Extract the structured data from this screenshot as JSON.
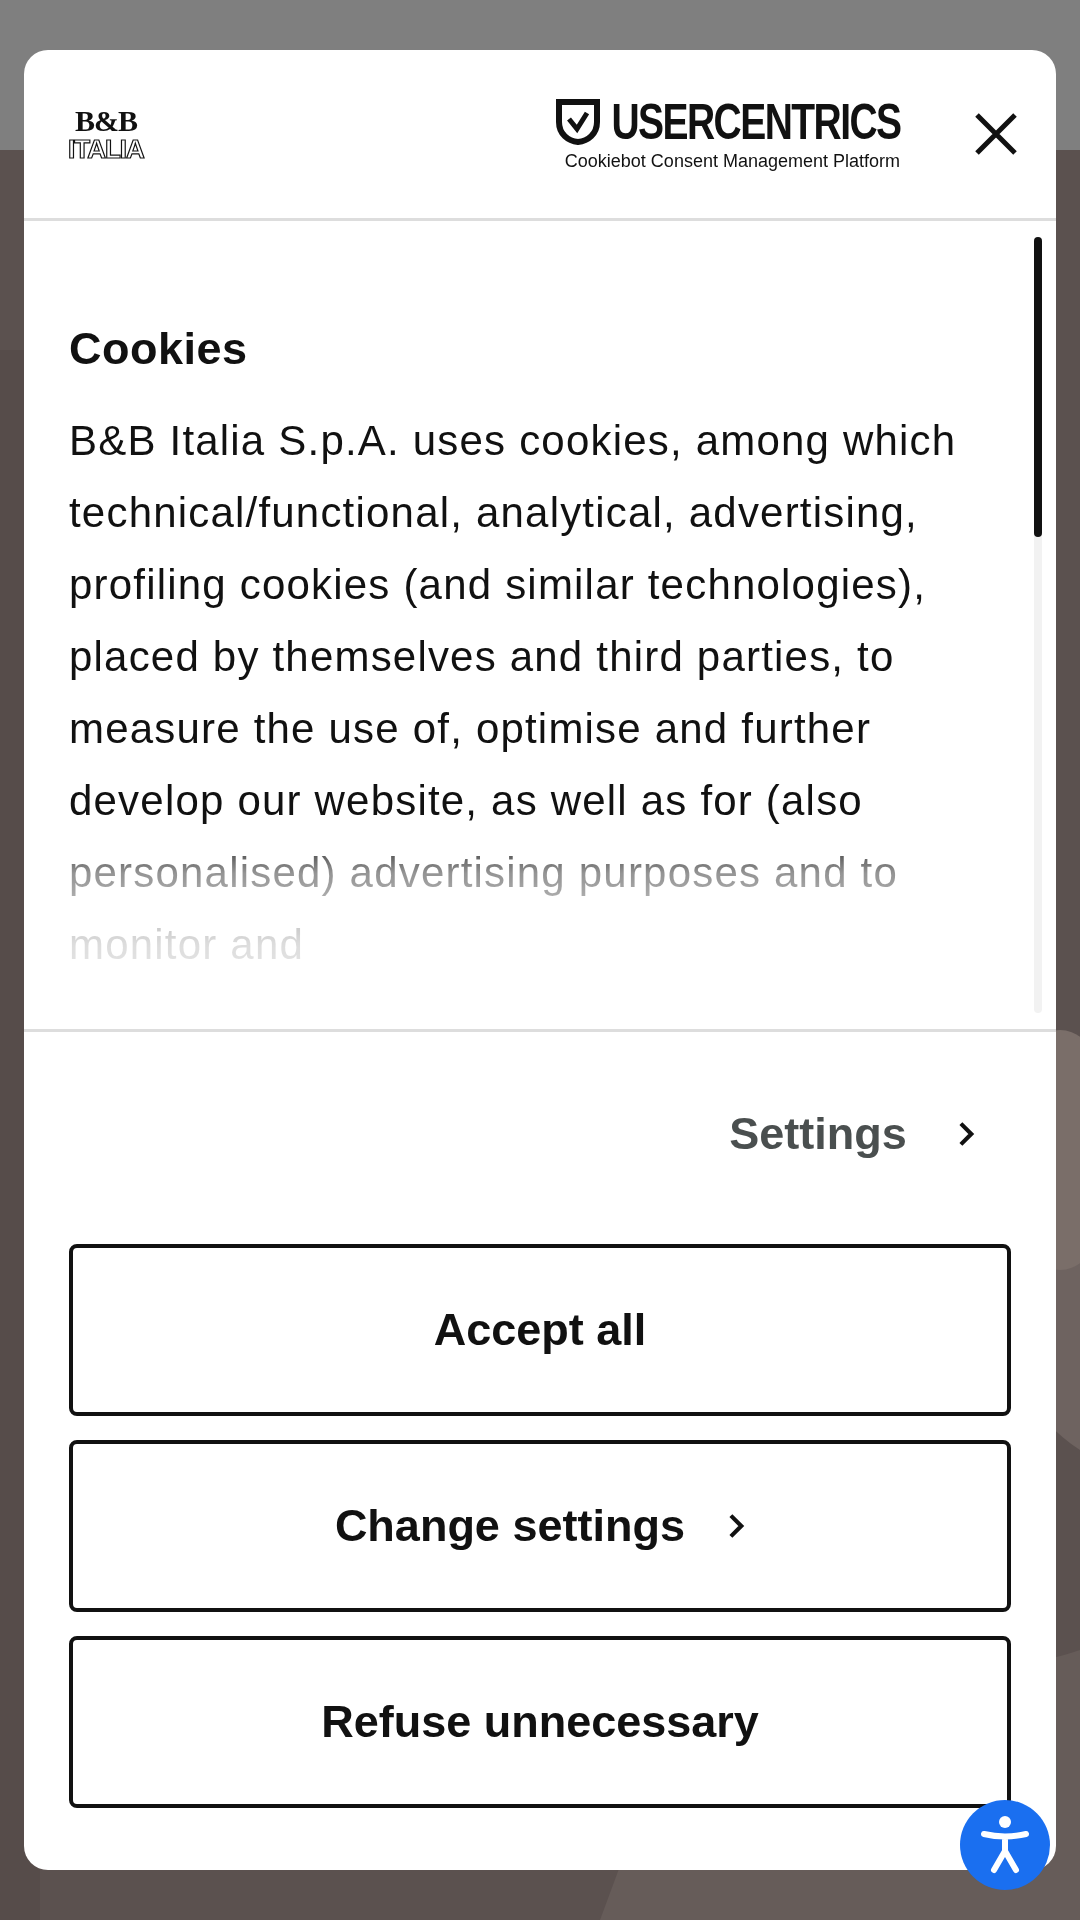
{
  "dialog": {
    "brand_logo": [
      "B&B",
      "ITALIA"
    ],
    "provider": {
      "name": "USERCENTRICS",
      "subtitle": "Cookiebot Consent Management Platform"
    },
    "title": "Cookies",
    "text": "B&B Italia S.p.A. uses cookies, among which technical/functional, analytical, advertising, profiling cookies (and similar technologies), placed by themselves and third parties, to measure the use of, optimise and further develop our website, as well as for (also personalised) advertising purposes and to monitor and",
    "settings_link": "Settings",
    "buttons": [
      {
        "label": "Accept all",
        "kind": "plain"
      },
      {
        "label": "Change settings",
        "kind": "chevron"
      },
      {
        "label": "Refuse unnecessary",
        "kind": "plain"
      }
    ]
  }
}
